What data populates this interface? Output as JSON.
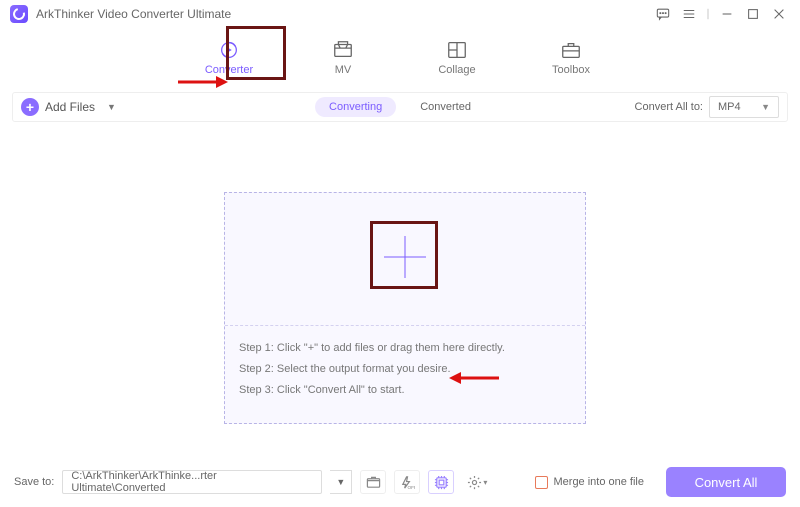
{
  "app": {
    "title": "ArkThinker Video Converter Ultimate"
  },
  "tabs": {
    "converter": "Converter",
    "mv": "MV",
    "collage": "Collage",
    "toolbox": "Toolbox"
  },
  "toolbar": {
    "add_files": "Add Files",
    "converting": "Converting",
    "converted": "Converted",
    "convert_all_to": "Convert All to:",
    "format": "MP4"
  },
  "steps": {
    "s1": "Step 1: Click \"+\" to add files or drag them here directly.",
    "s2": "Step 2: Select the output format you desire.",
    "s3": "Step 3: Click \"Convert All\" to start."
  },
  "footer": {
    "save_to": "Save to:",
    "path": "C:\\ArkThinker\\ArkThinke...rter Ultimate\\Converted",
    "merge": "Merge into one file",
    "cta": "Convert All"
  }
}
